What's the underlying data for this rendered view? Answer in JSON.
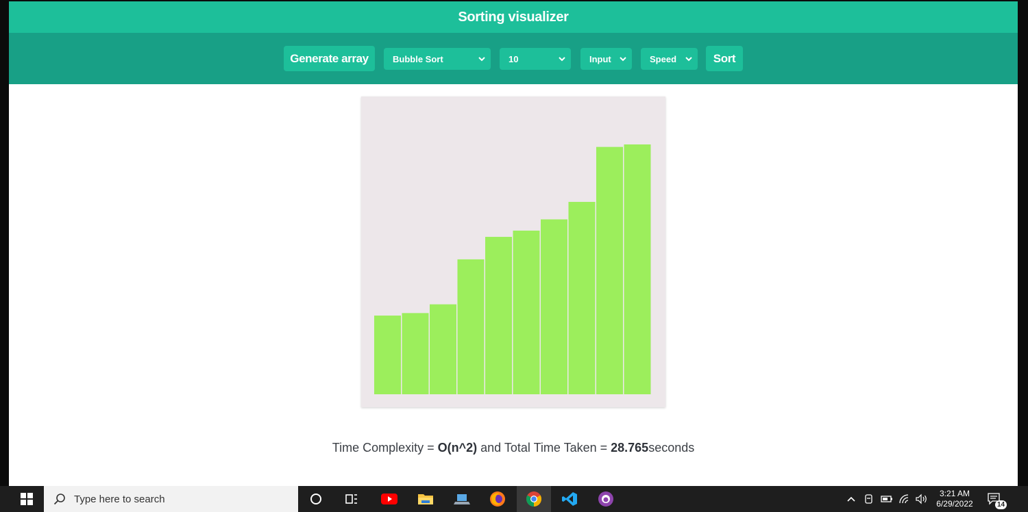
{
  "header": {
    "title": "Sorting visualizer"
  },
  "toolbar": {
    "generate_label": "Generate array",
    "algorithm": "Bubble Sort",
    "size": "10",
    "input": "Input",
    "speed": "Speed",
    "sort_label": "Sort"
  },
  "chart_data": {
    "type": "bar",
    "bar_color": "#9cee5c",
    "background": "#ede7ea",
    "ylim": [
      0,
      100
    ],
    "values": [
      31.5,
      32.5,
      36,
      54,
      63,
      65.5,
      70,
      77,
      99,
      100
    ]
  },
  "result": {
    "prefix": "Time Complexity = ",
    "complexity": "O(n^2)",
    "middle": " and Total Time Taken = ",
    "time": "28.765",
    "suffix": "seconds"
  },
  "taskbar": {
    "search_placeholder": "Type here to search",
    "time": "3:21 AM",
    "date": "6/29/2022",
    "notification_count": "14"
  }
}
